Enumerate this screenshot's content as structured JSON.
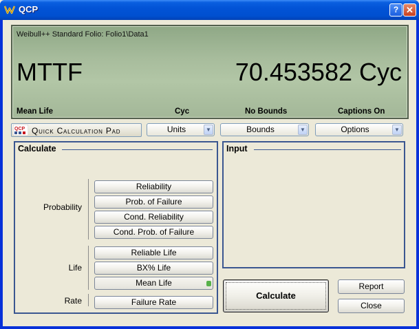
{
  "window": {
    "title": "QCP",
    "help_label": "?",
    "close_label": "✕"
  },
  "display": {
    "folio_path": "Weibull++ Standard Folio: Folio1\\Data1",
    "result_label": "MTTF",
    "result_value": "70.453582 Cyc",
    "footer": {
      "calculation": "Mean Life",
      "units": "Cyc",
      "bounds": "No Bounds",
      "captions": "Captions On"
    }
  },
  "toolbar": {
    "logo_text": "QCP",
    "pad_label": "Quick Calculation Pad",
    "units_label": "Units",
    "bounds_label": "Bounds",
    "options_label": "Options"
  },
  "calculate": {
    "title": "Calculate",
    "probability": {
      "label": "Probability",
      "buttons": [
        "Reliability",
        "Prob. of Failure",
        "Cond. Reliability",
        "Cond. Prob. of Failure"
      ]
    },
    "life": {
      "label": "Life",
      "buttons": [
        "Reliable Life",
        "BX% Life",
        "Mean Life"
      ]
    },
    "rate": {
      "label": "Rate",
      "buttons": [
        "Failure Rate"
      ]
    },
    "selected": "Mean Life"
  },
  "input": {
    "title": "Input"
  },
  "actions": {
    "calculate_label": "Calculate",
    "report_label": "Report",
    "close_label": "Close"
  },
  "colors": {
    "lcd_background": "#a7bc9c",
    "group_border": "#3a5690",
    "selected_indicator": "#58b14a",
    "titlebar": "#0253d6"
  }
}
